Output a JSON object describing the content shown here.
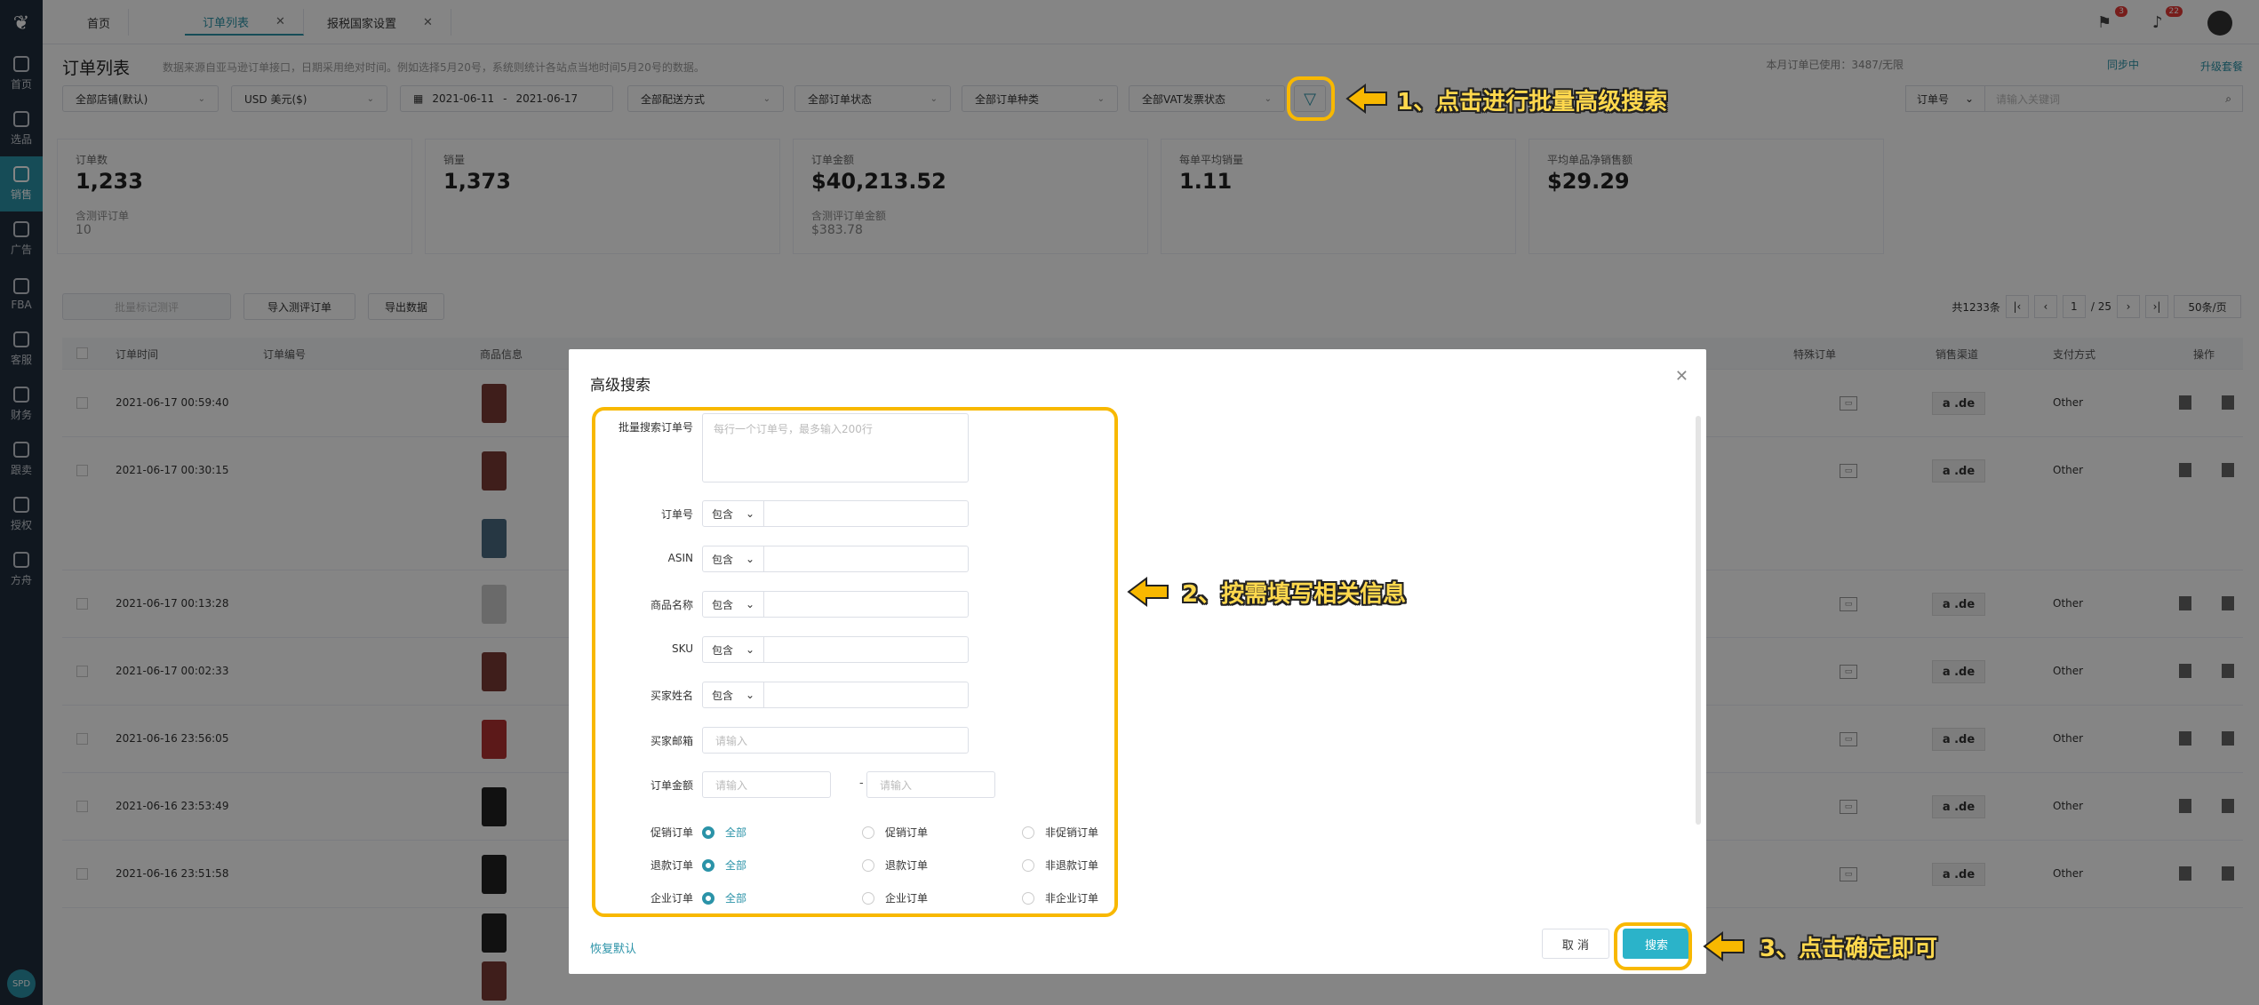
{
  "sidebar": {
    "logo": "❦",
    "items": [
      {
        "label": "首页"
      },
      {
        "label": "选品"
      },
      {
        "label": "销售"
      },
      {
        "label": "广告"
      },
      {
        "label": "FBA"
      },
      {
        "label": "客服"
      },
      {
        "label": "财务"
      },
      {
        "label": "跟卖"
      },
      {
        "label": "授权"
      },
      {
        "label": "方舟"
      }
    ],
    "bottom": "SPD"
  },
  "tabs": [
    {
      "label": "首页",
      "closable": false
    },
    {
      "label": "订单列表",
      "closable": true
    },
    {
      "label": "报税国家设置",
      "closable": true
    }
  ],
  "topbar": {
    "flag_badge": "3",
    "bell_badge": "22"
  },
  "page": {
    "title": "订单列表",
    "desc": "数据来源自亚马逊订单接口，日期采用绝对时间。例如选择5月20号，系统则统计各站点当地时间5月20号的数据。",
    "quota": "本月订单已使用：3487/无限",
    "sync_label": "同步中",
    "upgrade_label": "升级套餐"
  },
  "filters": {
    "store": "全部店铺(默认)",
    "currency": "USD 美元($)",
    "date_start": "2021-06-11",
    "date_sep": "-",
    "date_end": "2021-06-17",
    "delivery": "全部配送方式",
    "order_status": "全部订单状态",
    "order_type": "全部订单种类",
    "vat": "全部VAT发票状态",
    "search_field": "订单号",
    "search_placeholder": "请输入关键词"
  },
  "stats": [
    {
      "label": "订单数",
      "value": "1,233",
      "sub_label": "含测评订单",
      "sub_value": "10"
    },
    {
      "label": "销量",
      "value": "1,373",
      "sub_label": "",
      "sub_value": ""
    },
    {
      "label": "订单金额",
      "value": "$40,213.52",
      "sub_label": "含测评订单金额",
      "sub_value": "$383.78"
    },
    {
      "label": "每单平均销量",
      "value": "1.11",
      "sub_label": "",
      "sub_value": ""
    },
    {
      "label": "平均单品净销售额",
      "value": "$29.29",
      "sub_label": "",
      "sub_value": ""
    }
  ],
  "actions": {
    "batch_mark": "批量标记测评",
    "import_eval": "导入测评订单",
    "export": "导出数据"
  },
  "pager": {
    "total": "共1233条",
    "page": "1",
    "pages": "/ 25",
    "per_page": "50条/页"
  },
  "table": {
    "headers": {
      "time": "订单时间",
      "order_no": "订单编号",
      "product": "商品信息",
      "special": "特殊订单",
      "channel": "销售渠道",
      "payment": "支付方式",
      "ops": "操作"
    },
    "rows": [
      {
        "time": "2021-06-17 00:59:40",
        "channel": "a .de",
        "payment": "Other"
      },
      {
        "time": "2021-06-17 00:30:15",
        "channel": "a .de",
        "payment": "Other"
      },
      {
        "time": "2021-06-17 00:13:28",
        "channel": "a .de",
        "payment": "Other"
      },
      {
        "time": "2021-06-17 00:02:33",
        "channel": "a .de",
        "payment": "Other"
      },
      {
        "time": "2021-06-16 23:56:05",
        "channel": "a .de",
        "payment": "Other"
      },
      {
        "time": "2021-06-16 23:53:49",
        "channel": "a .de",
        "payment": "Other"
      },
      {
        "time": "2021-06-16 23:51:58",
        "channel": "a .de",
        "payment": "Other"
      }
    ]
  },
  "modal": {
    "title": "高级搜索",
    "batch_label": "批量搜索订单号",
    "batch_placeholder": "每行一个订单号，最多输入200行",
    "contain": "包含",
    "fields": [
      "订单号",
      "ASIN",
      "商品名称",
      "SKU",
      "买家姓名"
    ],
    "email_label": "买家邮箱",
    "email_placeholder": "请输入",
    "amount_label": "订单金额",
    "amount_min_placeholder": "请输入",
    "amount_max_placeholder": "请输入",
    "amount_sep": "-",
    "radio_groups": [
      {
        "label": "促销订单",
        "options": [
          "全部",
          "促销订单",
          "非促销订单"
        ]
      },
      {
        "label": "退款订单",
        "options": [
          "全部",
          "退款订单",
          "非退款订单"
        ]
      },
      {
        "label": "企业订单",
        "options": [
          "全部",
          "企业订单",
          "非企业订单"
        ]
      }
    ],
    "restore": "恢复默认",
    "cancel": "取 消",
    "search": "搜索"
  },
  "annotations": {
    "step1": "1、点击进行批量高级搜索",
    "step2": "2、按需填写相关信息",
    "step3": "3、点击确定即可",
    "color": "#f8b800"
  }
}
